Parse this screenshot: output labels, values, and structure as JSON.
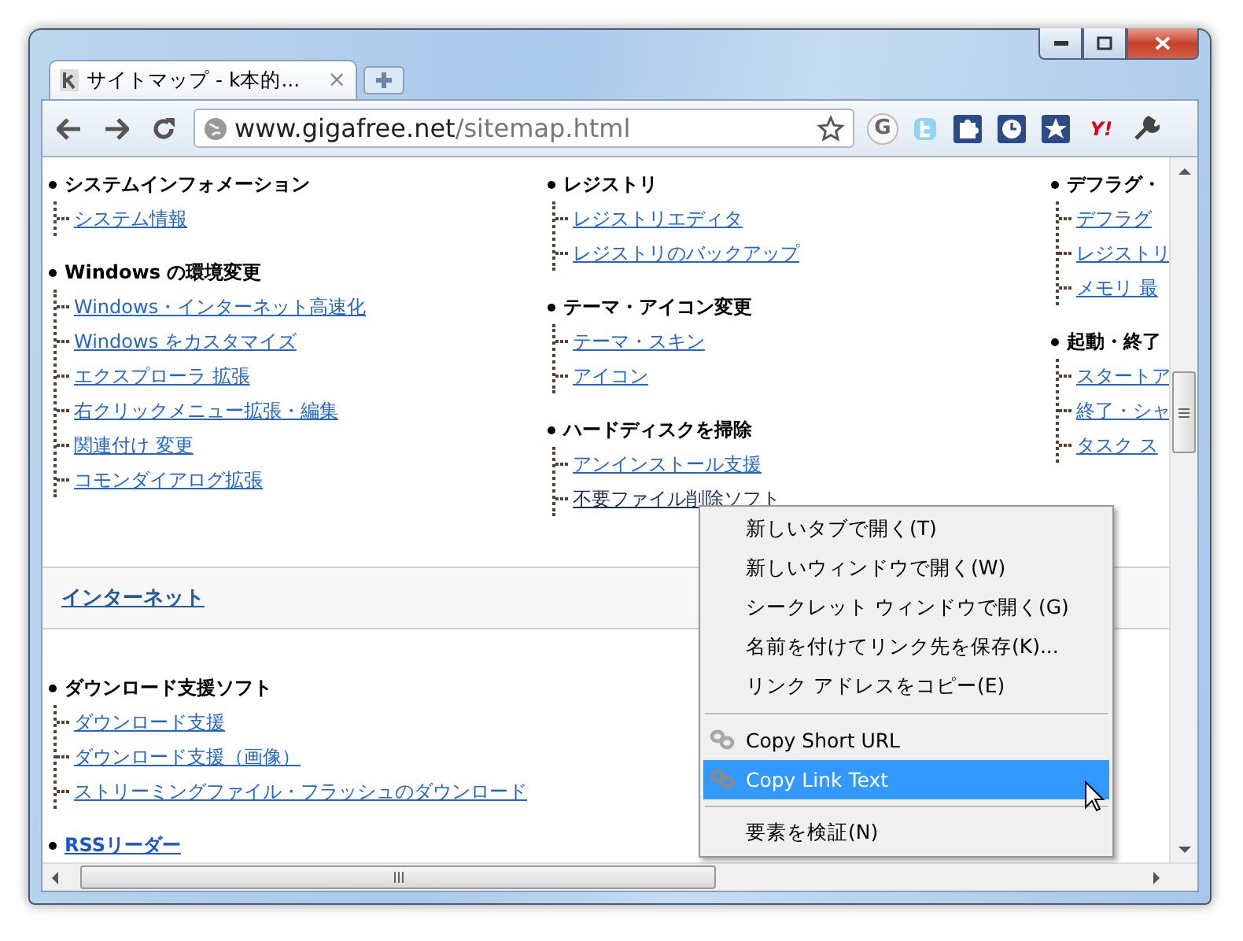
{
  "tab": {
    "title": "サイトマップ - k本的...",
    "close": "×"
  },
  "toolbar": {
    "url_host": "www.gigafree.net",
    "url_path": "/sitemap.html",
    "extensions": [
      {
        "kind": "google",
        "label": "G"
      },
      {
        "kind": "twitter"
      },
      {
        "kind": "puzzle"
      },
      {
        "kind": "clock"
      },
      {
        "kind": "star"
      },
      {
        "kind": "yahoo",
        "label": "Y!"
      },
      {
        "kind": "wrench"
      }
    ]
  },
  "columns": [
    [
      {
        "heading": "システムインフォメーション",
        "links": [
          {
            "label": "システム情報",
            "active": false
          }
        ]
      },
      {
        "heading": "Windows の環境変更",
        "links": [
          {
            "label": "Windows・インターネット高速化",
            "active": false
          },
          {
            "label": "Windows をカスタマイズ",
            "active": false
          },
          {
            "label": "エクスプローラ 拡張",
            "active": false
          },
          {
            "label": "右クリックメニュー拡張・編集",
            "active": false
          },
          {
            "label": "関連付け 変更",
            "active": false
          },
          {
            "label": "コモンダイアログ拡張",
            "active": false
          }
        ]
      }
    ],
    [
      {
        "heading": "レジストリ",
        "links": [
          {
            "label": "レジストリエディタ",
            "active": false
          },
          {
            "label": "レジストリのバックアップ",
            "active": false
          }
        ]
      },
      {
        "heading": "テーマ・アイコン変更",
        "links": [
          {
            "label": "テーマ・スキン",
            "active": false
          },
          {
            "label": "アイコン",
            "active": false
          }
        ]
      },
      {
        "heading": "ハードディスクを掃除",
        "links": [
          {
            "label": "アンインストール支援",
            "active": false
          },
          {
            "label": "不要ファイル削除ソフト",
            "active": true
          }
        ]
      }
    ],
    [
      {
        "heading": "デフラグ・",
        "links": [
          {
            "label": "デフラグ",
            "active": false
          },
          {
            "label": "レジストリ",
            "active": false
          },
          {
            "label": "メモリ 最",
            "active": false
          }
        ]
      },
      {
        "heading": "起動・終了",
        "links": [
          {
            "label": "スタートア",
            "active": false
          },
          {
            "label": "終了・シャ",
            "active": false
          },
          {
            "label": "タスク ス",
            "active": false
          }
        ]
      }
    ]
  ],
  "band": {
    "title": "インターネット"
  },
  "lower_sections": [
    {
      "heading": "ダウンロード支援ソフト",
      "heading_is_link": false,
      "links": [
        {
          "label": "ダウンロード支援",
          "active": false
        },
        {
          "label": "ダウンロード支援（画像）",
          "active": false
        },
        {
          "label": "ストリーミングファイル・フラッシュのダウンロード",
          "active": false
        }
      ]
    },
    {
      "heading": "RSSリーダー",
      "heading_is_link": true
    }
  ],
  "context_menu": {
    "groups": [
      [
        {
          "label": "新しいタブで開く(T)",
          "kind": "plain",
          "selected": false
        },
        {
          "label": "新しいウィンドウで開く(W)",
          "kind": "plain",
          "selected": false
        },
        {
          "label": "シークレット ウィンドウで開く(G)",
          "kind": "plain",
          "selected": false
        },
        {
          "label": "名前を付けてリンク先を保存(K)...",
          "kind": "plain",
          "selected": false
        },
        {
          "label": "リンク アドレスをコピー(E)",
          "kind": "plain",
          "selected": false
        }
      ],
      [
        {
          "label": "Copy Short URL",
          "kind": "chain",
          "selected": false
        },
        {
          "label": "Copy Link Text",
          "kind": "chain",
          "selected": true
        }
      ],
      [
        {
          "label": "要素を検証(N)",
          "kind": "plain",
          "selected": false
        }
      ]
    ]
  }
}
